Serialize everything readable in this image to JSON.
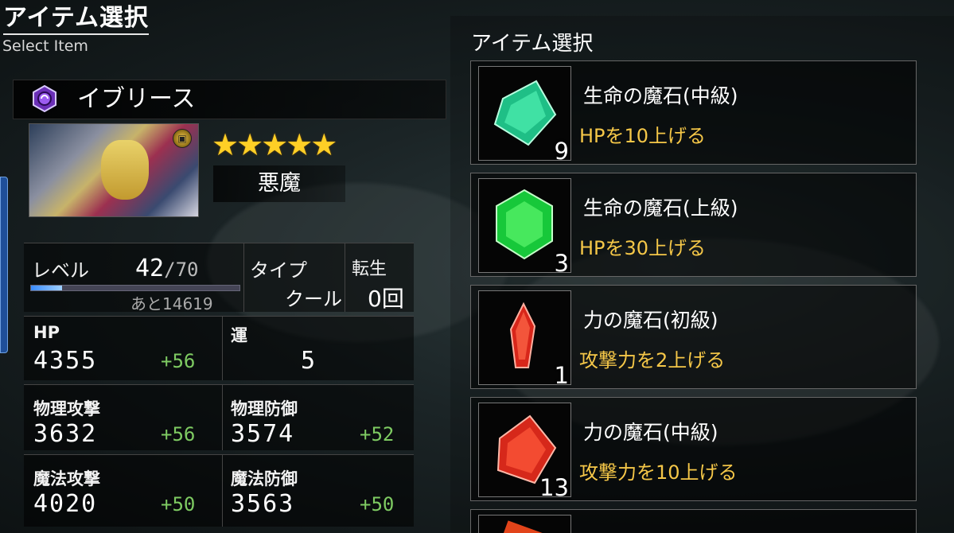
{
  "header": {
    "title": "アイテム選択",
    "subtitle": "Select Item"
  },
  "character": {
    "name": "イブリース",
    "rarity_stars": 5,
    "stars_text": "★★★★★",
    "race": "悪魔",
    "level_label": "レベル",
    "level": "42",
    "level_max": "/70",
    "exp_remaining": "あと14619",
    "exp_progress": 0.15,
    "type_label": "タイプ",
    "type": "クール",
    "rebirth_label": "転生",
    "rebirth": "0回",
    "stats": {
      "hp_label": "HP",
      "hp": "4355",
      "hp_bonus": "+56",
      "luck_label": "運",
      "luck": "5",
      "phys_atk_label": "物理攻撃",
      "phys_atk": "3632",
      "phys_atk_bonus": "+56",
      "phys_def_label": "物理防御",
      "phys_def": "3574",
      "phys_def_bonus": "+52",
      "mag_atk_label": "魔法攻撃",
      "mag_atk": "4020",
      "mag_atk_bonus": "+50",
      "mag_def_label": "魔法防御",
      "mag_def": "3563",
      "mag_def_bonus": "+50"
    }
  },
  "item_panel": {
    "title": "アイテム選択",
    "items": [
      {
        "name": "生命の魔石(中級)",
        "desc": "HPを10上げる",
        "count": "9",
        "color": "#2fd98a"
      },
      {
        "name": "生命の魔石(上級)",
        "desc": "HPを30上げる",
        "count": "3",
        "color": "#27e24a"
      },
      {
        "name": "力の魔石(初級)",
        "desc": "攻撃力を2上げる",
        "count": "1",
        "color": "#e83a24"
      },
      {
        "name": "力の魔石(中級)",
        "desc": "攻撃力を10上げる",
        "count": "13",
        "color": "#e8321c"
      }
    ]
  },
  "colors": {
    "accent_text": "#f5c748",
    "bonus": "#7ecb62",
    "star": "#ffcf26"
  }
}
